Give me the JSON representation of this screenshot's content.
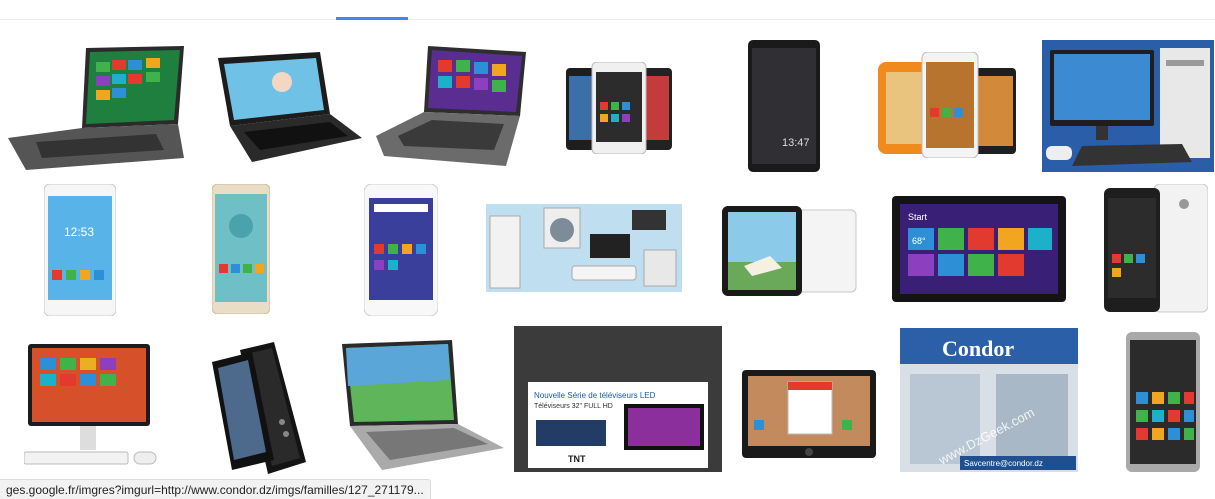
{
  "header": {
    "active_tab_indicator_color": "#4285f4"
  },
  "results": {
    "row1": [
      {
        "name": "laptop-windows8-silver"
      },
      {
        "name": "netbook-black"
      },
      {
        "name": "laptop-windows8-gray"
      },
      {
        "name": "smartphones-group"
      },
      {
        "name": "tablet-dark-clock"
      },
      {
        "name": "kids-tablet-orange-and-phones"
      },
      {
        "name": "desktop-computer-tower"
      }
    ],
    "row2": [
      {
        "name": "smartphone-white"
      },
      {
        "name": "smartphone-gold"
      },
      {
        "name": "smartphone-white-android"
      },
      {
        "name": "home-appliances-set"
      },
      {
        "name": "tablet-black-and-white"
      },
      {
        "name": "windows-tablet-black"
      },
      {
        "name": "smartphone-white-with-case"
      }
    ],
    "row3": [
      {
        "name": "all-in-one-pc-windows8"
      },
      {
        "name": "flip-phone-black"
      },
      {
        "name": "laptop-green-wallpaper"
      },
      {
        "name": "led-tv-advertisement"
      },
      {
        "name": "tablet-calendar-app"
      },
      {
        "name": "condor-storefront"
      },
      {
        "name": "smartphone-dark-tiles"
      }
    ]
  },
  "ad_tile": {
    "headline": "Nouvelle Série de téléviseurs LED",
    "subline": "Téléviseurs 32\" FULL HD",
    "logo_text": "TNT"
  },
  "storefront_tile": {
    "sign_text": "Condor",
    "watermark": "www.DzGeek.com",
    "email": "Savcentre@condor.dz"
  },
  "tablet_clock": {
    "time": "13:47"
  },
  "phone_clock": {
    "time": "12:53"
  },
  "windows_tablet": {
    "start_label": "Start",
    "temp": "68°"
  },
  "status_bar": {
    "url": "ges.google.fr/imgres?imgurl=http://www.condor.dz/imgs/familles/127_271179..."
  }
}
